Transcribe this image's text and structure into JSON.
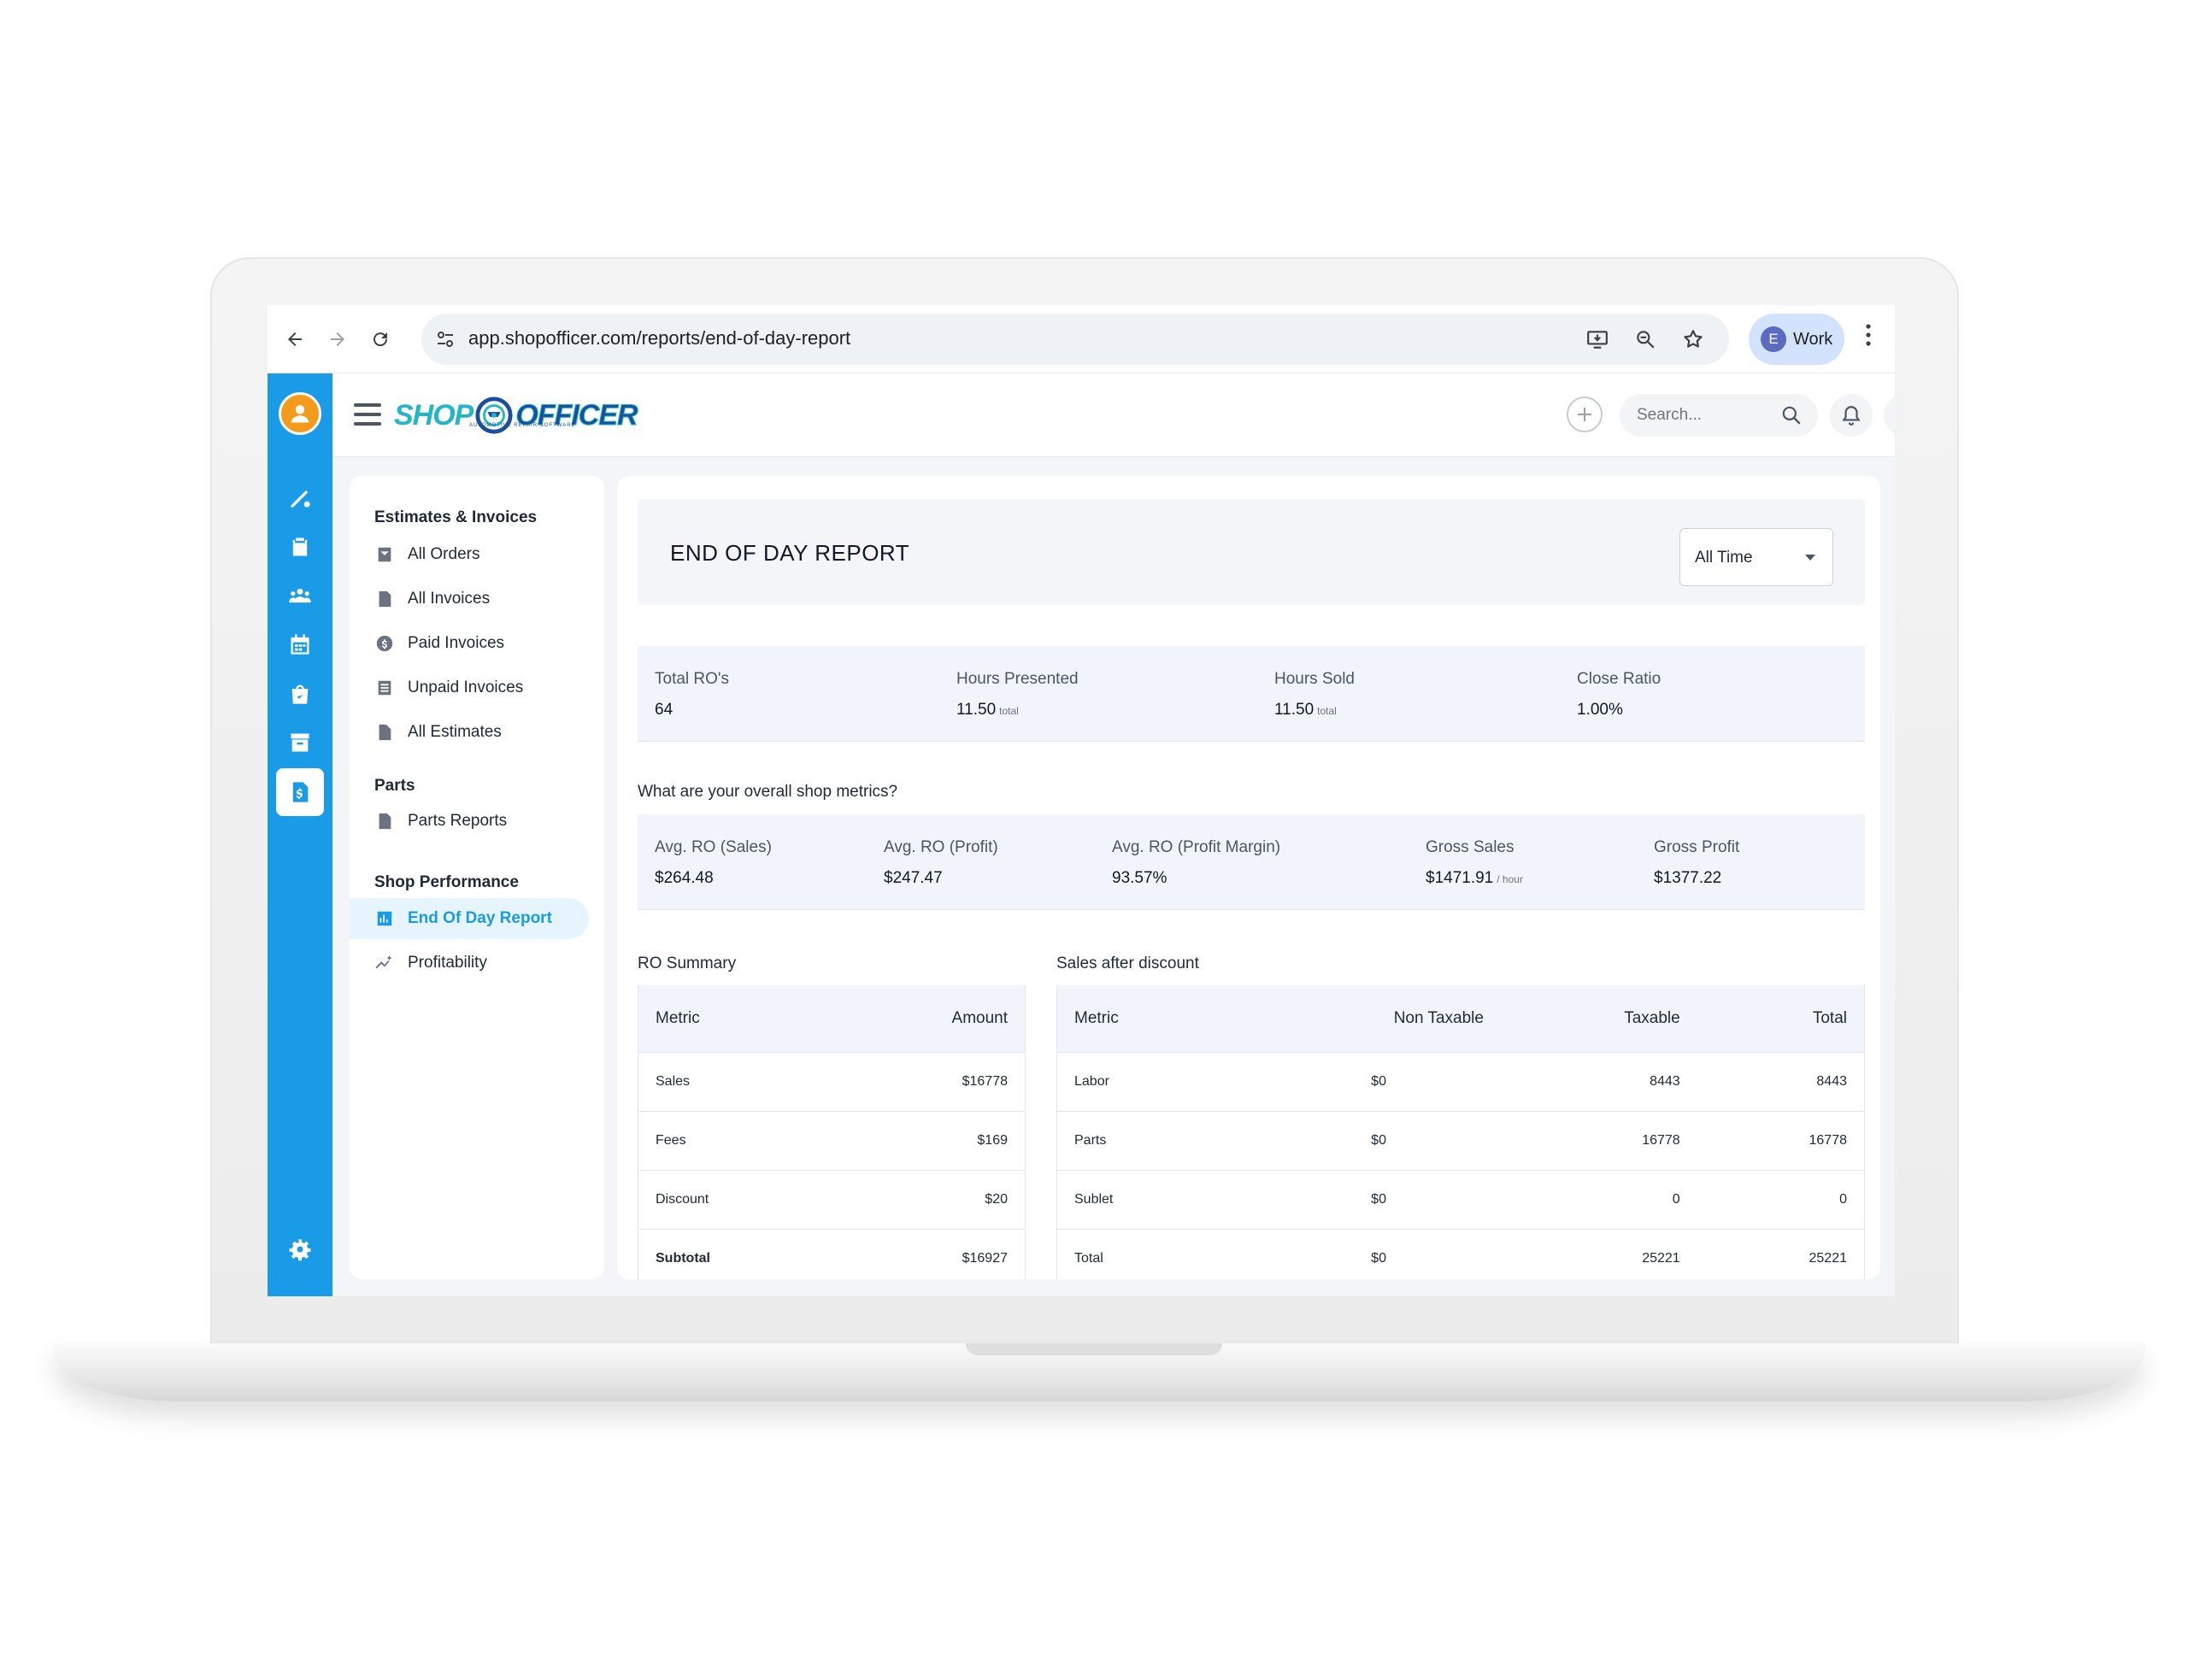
{
  "browser": {
    "url": "app.shopofficer.com/reports/end-of-day-report",
    "profile_initial": "E",
    "profile_label": "Work"
  },
  "logo": {
    "part1": "SHOP",
    "part2": "OFFICER",
    "tagline": "AUTOMOTIVE REPAIR SOFTWARE"
  },
  "header": {
    "search_placeholder": "Search..."
  },
  "submenu": {
    "sections": [
      {
        "heading": "Estimates & Invoices",
        "items": [
          "All Orders",
          "All Invoices",
          "Paid Invoices",
          "Unpaid Invoices",
          "All Estimates"
        ]
      },
      {
        "heading": "Parts",
        "items": [
          "Parts Reports"
        ]
      },
      {
        "heading": "Shop Performance",
        "items": [
          "End Of Day Report",
          "Profitability"
        ]
      }
    ],
    "active_item": "End Of Day Report"
  },
  "report": {
    "title": "END OF DAY REPORT",
    "time_filter": "All Time",
    "summary_metrics": [
      {
        "label": "Total RO's",
        "value": "64",
        "unit": ""
      },
      {
        "label": "Hours Presented",
        "value": "11.50",
        "unit": "total"
      },
      {
        "label": "Hours Sold",
        "value": "11.50",
        "unit": "total"
      },
      {
        "label": "Close Ratio",
        "value": "1.00%",
        "unit": ""
      }
    ],
    "question": "What are your overall shop metrics?",
    "shop_metrics": [
      {
        "label": "Avg. RO (Sales)",
        "value": "$264.48",
        "unit": ""
      },
      {
        "label": "Avg. RO (Profit)",
        "value": "$247.47",
        "unit": ""
      },
      {
        "label": "Avg. RO (Profit Margin)",
        "value": "93.57%",
        "unit": ""
      },
      {
        "label": "Gross Sales",
        "value": "$1471.91",
        "unit": "/ hour"
      },
      {
        "label": "Gross Profit",
        "value": "$1377.22",
        "unit": ""
      }
    ],
    "ro_summary": {
      "caption": "RO Summary",
      "headers": [
        "Metric",
        "Amount"
      ],
      "rows": [
        [
          "Sales",
          "$16778"
        ],
        [
          "Fees",
          "$169"
        ],
        [
          "Discount",
          "$20"
        ],
        [
          "Subtotal",
          "$16927"
        ]
      ]
    },
    "sales_after_discount": {
      "caption": "Sales after discount",
      "headers": [
        "Metric",
        "Non Taxable",
        "Taxable",
        "Total"
      ],
      "rows": [
        [
          "Labor",
          "$0",
          "8443",
          "8443"
        ],
        [
          "Parts",
          "$0",
          "16778",
          "16778"
        ],
        [
          "Sublet",
          "$0",
          "0",
          "0"
        ],
        [
          "Total",
          "$0",
          "25221",
          "25221"
        ]
      ]
    }
  }
}
